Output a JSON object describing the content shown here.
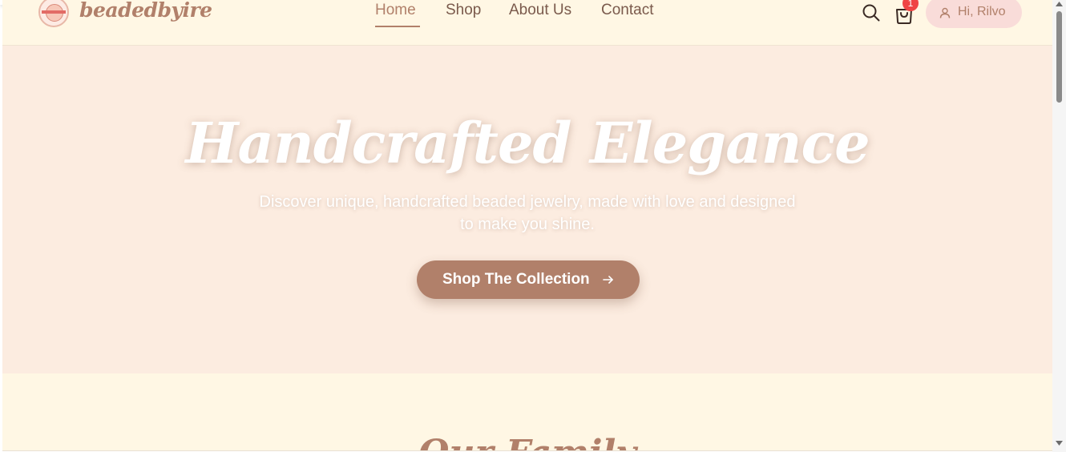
{
  "brand": {
    "name": "beadedbyire",
    "logo_icon": "brand-badge-icon"
  },
  "nav": {
    "items": [
      {
        "label": "Home",
        "active": true
      },
      {
        "label": "Shop",
        "active": false
      },
      {
        "label": "About Us",
        "active": false
      },
      {
        "label": "Contact",
        "active": false
      }
    ]
  },
  "header": {
    "search_icon": "search-icon",
    "cart_icon": "shopping-bag-icon",
    "cart_count": "1",
    "user_label": "Hi, Rilvo",
    "user_icon": "user-icon"
  },
  "hero": {
    "title": "Handcrafted Elegance",
    "subtitle": "Discover unique, handcrafted beaded jewelry, made with love and designed to make you shine.",
    "cta_label": "Shop The Collection",
    "cta_icon": "arrow-right-icon"
  },
  "section2": {
    "title": "Our Family"
  },
  "colors": {
    "accent": "#b1806a",
    "header_bg": "#fff7e4",
    "hero_bg": "#fcece0",
    "badge": "#ef4444",
    "user_pill": "#f9dcd9"
  }
}
